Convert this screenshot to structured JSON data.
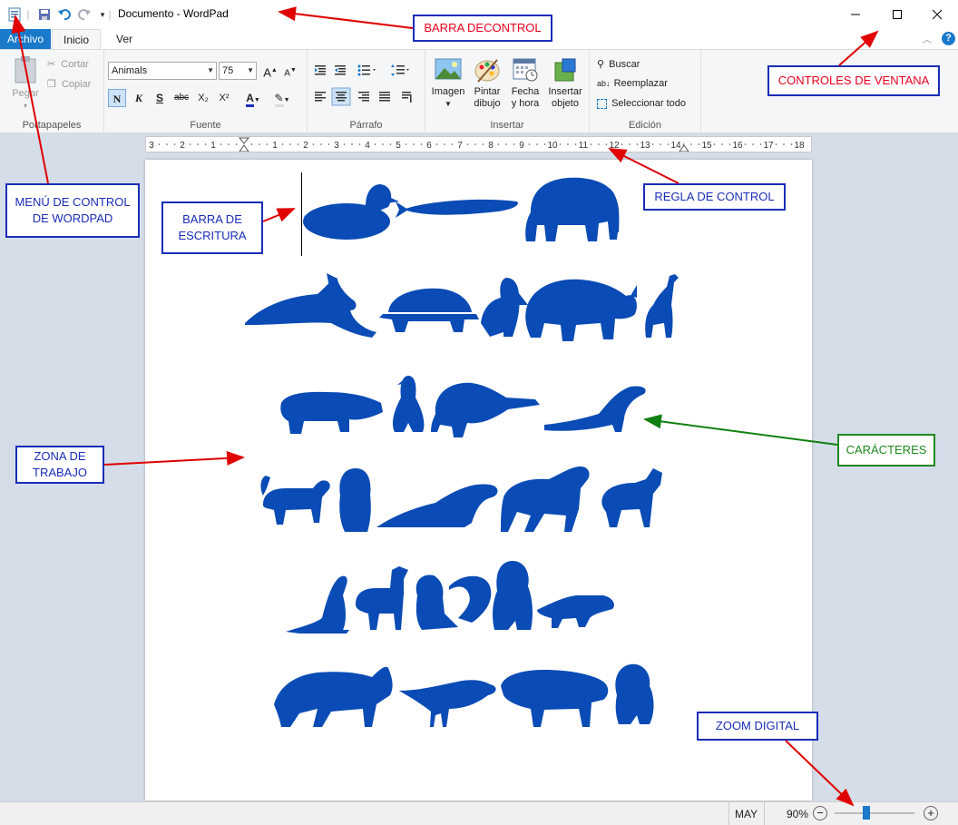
{
  "window": {
    "title": "Documento - WordPad",
    "tabs": [
      "Archivo",
      "Inicio",
      "Ver"
    ]
  },
  "ribbon": {
    "clipboard": {
      "paste": "Pegar",
      "cut": "Cortar",
      "copy": "Copiar",
      "label": "Portapapeles"
    },
    "font": {
      "family": "Animals",
      "size": "75",
      "label": "Fuente",
      "bold": "N",
      "italic": "K",
      "underline": "S",
      "strike": "abc",
      "subscript": "X₂",
      "superscript": "X²"
    },
    "paragraph": {
      "label": "Párrafo"
    },
    "insert": {
      "image": "Imagen",
      "paint": [
        "Pintar",
        "dibujo"
      ],
      "datetime": [
        "Fecha",
        "y hora"
      ],
      "object": [
        "Insertar",
        "objeto"
      ],
      "label": "Insertar"
    },
    "edit": {
      "find": "Buscar",
      "replace": "Reemplazar",
      "select_all": "Seleccionar todo",
      "label": "Edición"
    }
  },
  "ruler": {
    "left_numbers": [
      "3",
      "2",
      "1"
    ],
    "right_numbers": [
      "1",
      "2",
      "3",
      "4",
      "5",
      "6",
      "7",
      "8",
      "9",
      "10",
      "11",
      "12",
      "13",
      "14",
      "15",
      "16",
      "17",
      "18"
    ]
  },
  "statusbar": {
    "caps": "MAY",
    "zoom": "90%",
    "zoom_level": 0.4
  },
  "annotations": {
    "barra_control": "BARRA DECONTROL",
    "controles_ventana": "CONTROLES DE VENTANA",
    "menu_control": [
      "MENÚ DE CONTROL",
      "DE WORDPAD"
    ],
    "barra_escritura": [
      "BARRA DE",
      "ESCRITURA"
    ],
    "regla_control": "REGLA DE CONTROL",
    "caracteres": "CARÁCTERES",
    "zona_trabajo": [
      "ZONA DE",
      "TRABAJO"
    ],
    "zoom_digital": "ZOOM DIGITAL"
  },
  "colors": {
    "accent": "#1979ca",
    "animals": "#0a4bb5",
    "arrow_red": "#e00000",
    "arrow_green": "#108010"
  }
}
